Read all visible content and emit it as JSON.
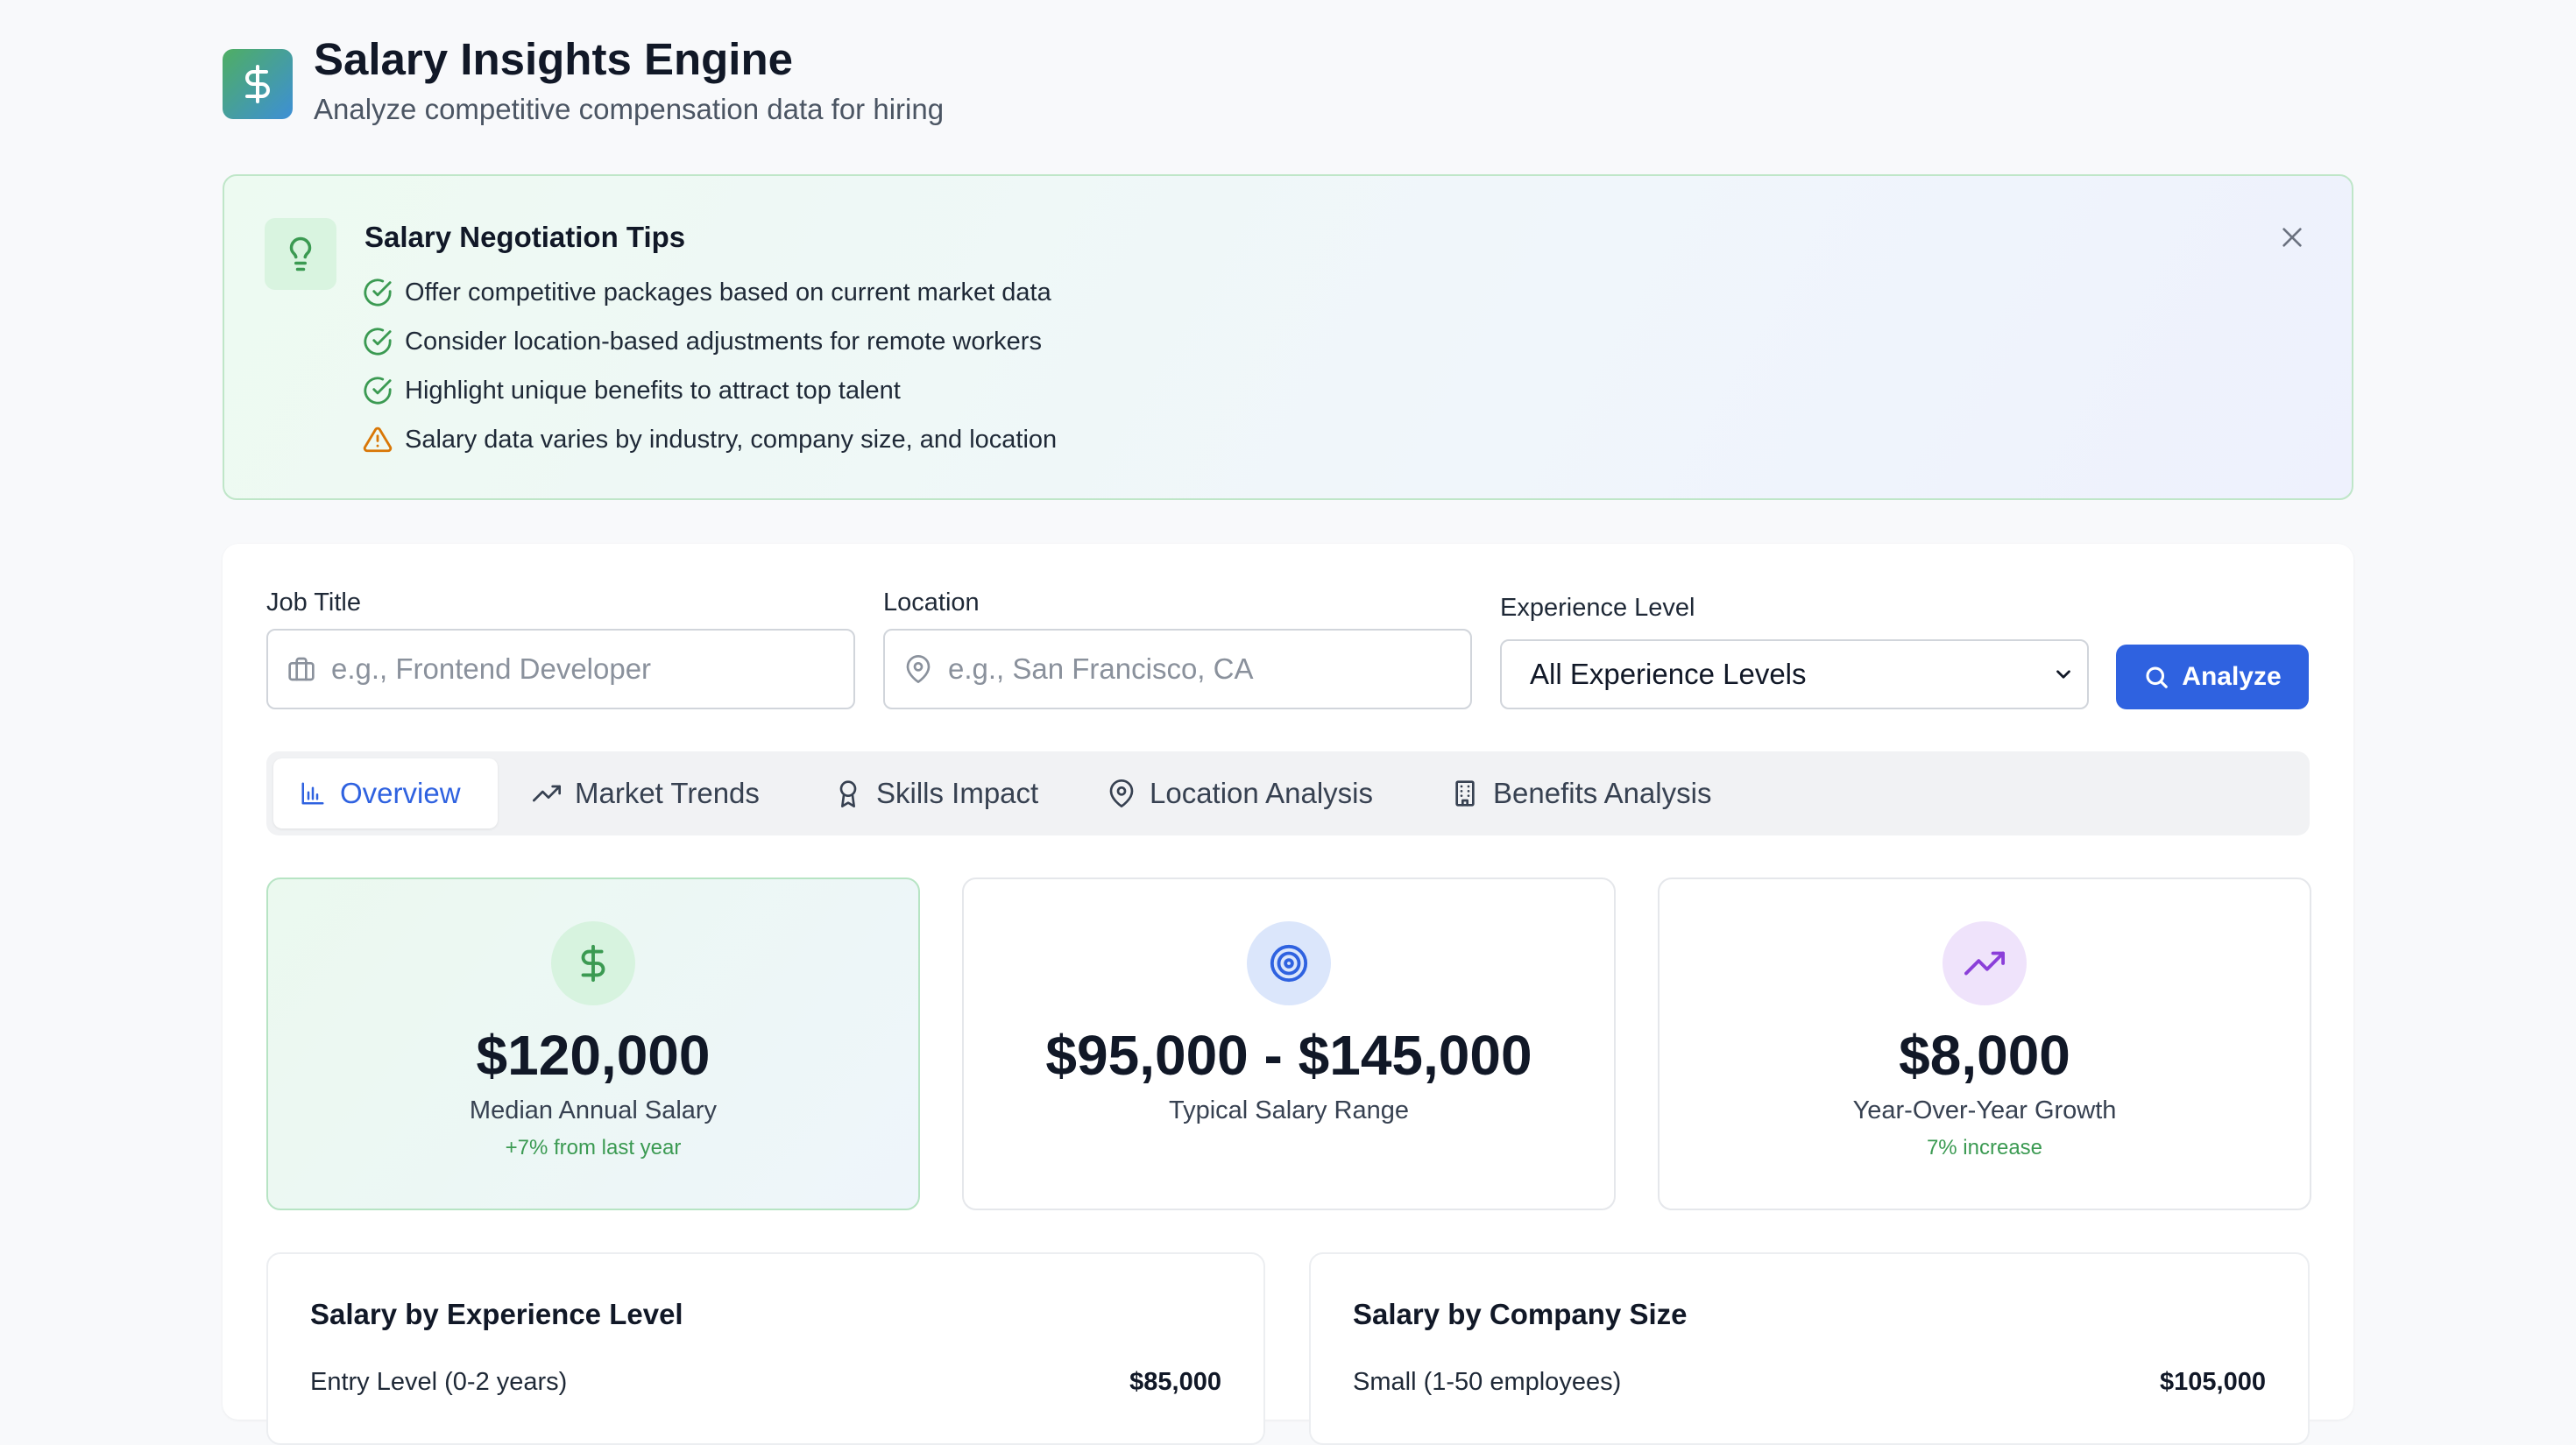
{
  "header": {
    "title": "Salary Insights Engine",
    "subtitle": "Analyze competitive compensation data for hiring",
    "logo_icon": "dollar-icon"
  },
  "tips": {
    "title": "Salary Negotiation Tips",
    "items": [
      {
        "text": "Offer competitive packages based on current market data",
        "icon": "check-circle-icon"
      },
      {
        "text": "Consider location-based adjustments for remote workers",
        "icon": "check-circle-icon"
      },
      {
        "text": "Highlight unique benefits to attract top talent",
        "icon": "check-circle-icon"
      },
      {
        "text": "Salary data varies by industry, company size, and location",
        "icon": "warning-icon"
      }
    ]
  },
  "search": {
    "job_title_label": "Job Title",
    "job_title_placeholder": "e.g., Frontend Developer",
    "location_label": "Location",
    "location_placeholder": "e.g., San Francisco, CA",
    "experience_label": "Experience Level",
    "experience_value": "All Experience Levels",
    "analyze_label": "Analyze"
  },
  "tabs": [
    {
      "label": "Overview",
      "icon": "bar-chart-icon",
      "active": true
    },
    {
      "label": "Market Trends",
      "icon": "trending-up-icon",
      "active": false
    },
    {
      "label": "Skills Impact",
      "icon": "award-icon",
      "active": false
    },
    {
      "label": "Location Analysis",
      "icon": "map-pin-icon",
      "active": false
    },
    {
      "label": "Benefits Analysis",
      "icon": "building-icon",
      "active": false
    }
  ],
  "stats": [
    {
      "value": "$120,000",
      "label": "Median Annual Salary",
      "note": "+7% from last year",
      "icon": "dollar-icon"
    },
    {
      "value": "$95,000 - $145,000",
      "label": "Typical Salary Range",
      "note": "",
      "icon": "target-icon"
    },
    {
      "value": "$8,000",
      "label": "Year-Over-Year Growth",
      "note": "7% increase",
      "icon": "trending-up-icon"
    }
  ],
  "experience_breakdown": {
    "title": "Salary by Experience Level",
    "rows": [
      {
        "label": "Entry Level (0-2 years)",
        "value": "$85,000"
      }
    ]
  },
  "company_breakdown": {
    "title": "Salary by Company Size",
    "rows": [
      {
        "label": "Small (1-50 employees)",
        "value": "$105,000"
      }
    ]
  },
  "colors": {
    "accent": "#2f62e0",
    "success": "#3b9a52",
    "warning": "#d97706",
    "background": "#f8f9fb"
  }
}
